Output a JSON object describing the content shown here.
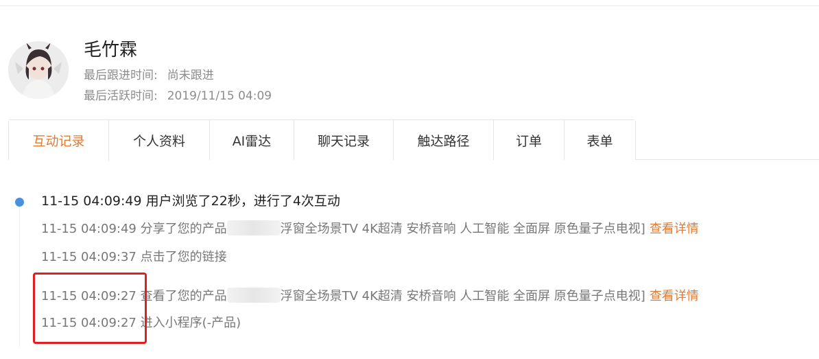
{
  "user": {
    "name": "毛竹霖",
    "last_follow_label": "最后跟进时间:",
    "last_follow_value": "尚未跟进",
    "last_active_label": "最后活跃时间:",
    "last_active_value": "2019/11/15 04:09"
  },
  "tabs": [
    {
      "label": "互动记录",
      "active": true
    },
    {
      "label": "个人资料",
      "active": false
    },
    {
      "label": "AI雷达",
      "active": false
    },
    {
      "label": "聊天记录",
      "active": false
    },
    {
      "label": "触达路径",
      "active": false
    },
    {
      "label": "订单",
      "active": false
    },
    {
      "label": "表单",
      "active": false
    }
  ],
  "timeline": {
    "session": {
      "time": "11-15 04:09:49",
      "text": "用户浏览了22秒，进行了4次互动"
    },
    "events": [
      {
        "time": "11-15 04:09:49",
        "text_before": "分享了您的产品",
        "text_after": "浮窗全场景TV 4K超清 安桥音响 人工智能 全面屏 原色量子点电视]",
        "link": "查看详情"
      },
      {
        "time": "11-15 04:09:37",
        "text": "点击了您的链接"
      },
      {
        "time": "11-15 04:09:27",
        "text_before": "查看了您的产品",
        "text_after": "浮窗全场景TV 4K超清 安桥音响 人工智能 全面屏 原色量子点电视]",
        "link": "查看详情"
      },
      {
        "time": "11-15 04:09:27",
        "text": "进入小程序(-产品)"
      }
    ]
  },
  "colors": {
    "accent": "#e07b33",
    "timeline_dot": "#4a90e2",
    "highlight": "#e02020"
  }
}
